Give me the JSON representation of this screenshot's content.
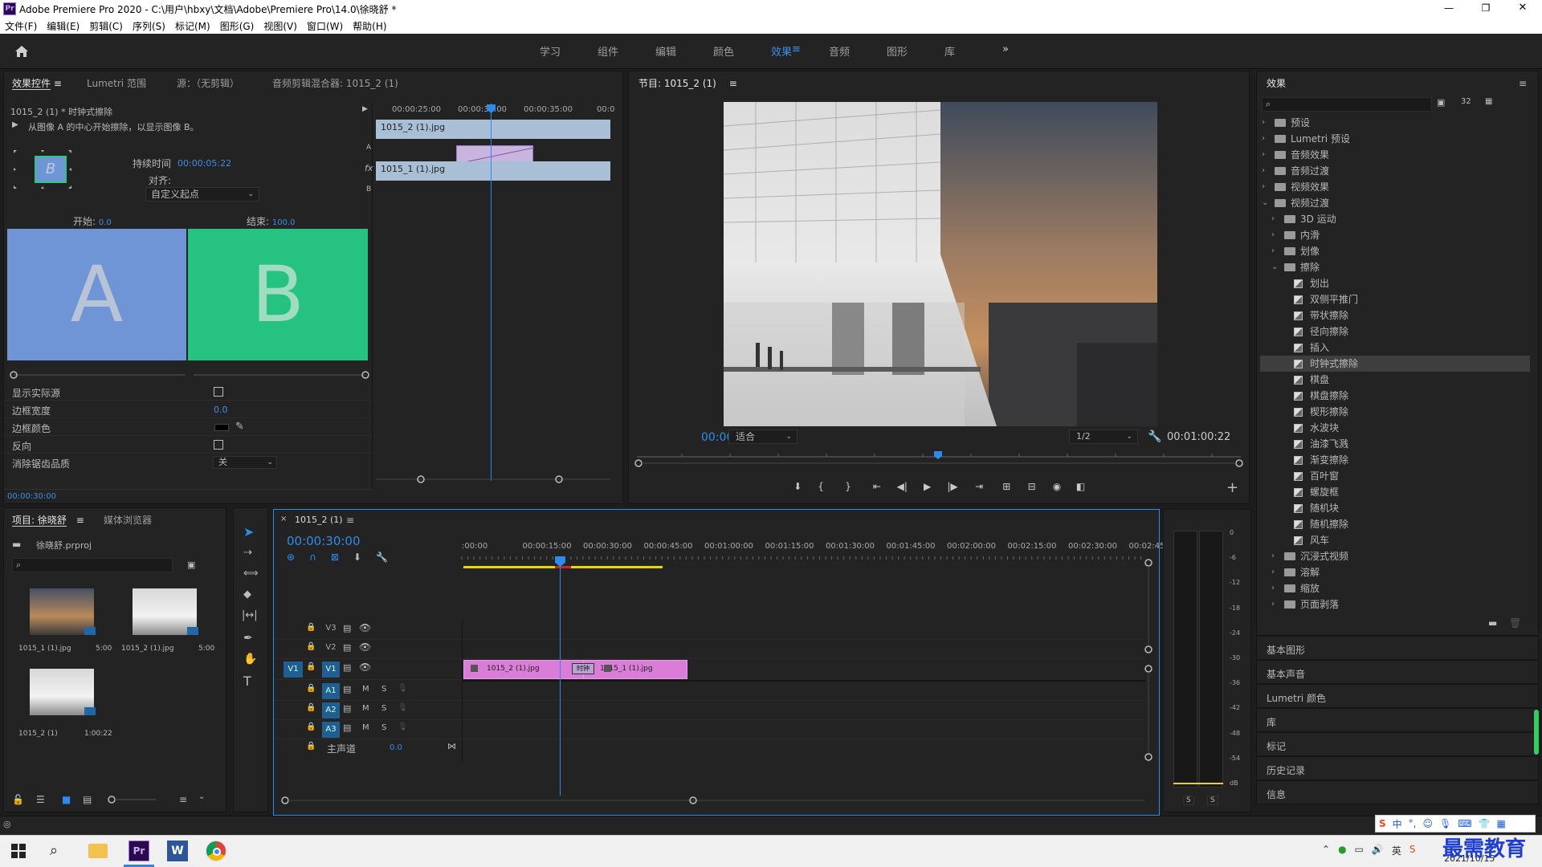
{
  "window": {
    "title": "Adobe Premiere Pro 2020 - C:\\用户\\hbxy\\文档\\Adobe\\Premiere Pro\\14.0\\徐晓舒 *",
    "app_icon": "Pr",
    "controls": [
      "—",
      "❐",
      "✕"
    ]
  },
  "menu": [
    "文件(F)",
    "编辑(E)",
    "剪辑(C)",
    "序列(S)",
    "标记(M)",
    "图形(G)",
    "视图(V)",
    "窗口(W)",
    "帮助(H)"
  ],
  "workspaces": {
    "items": [
      "学习",
      "组件",
      "编辑",
      "颜色",
      "效果",
      "音频",
      "图形",
      "库"
    ],
    "active": "效果",
    "more": "»"
  },
  "effect_controls": {
    "tabs": [
      "效果控件",
      "Lumetri 范围",
      "源：（无剪辑）",
      "音频剪辑混合器: 1015_2 (1)"
    ],
    "clip_title": "1015_2 (1) * 时钟式擦除",
    "description": "从图像 A 的中心开始擦除，以显示图像 B。",
    "thumb_letter": "B",
    "duration_label": "持续时间",
    "duration_value": "00:00:05:22",
    "align_label": "对齐:",
    "align_value": "自定义起点",
    "start_label": "开始:",
    "start_value": "0.0",
    "end_label": "结束:",
    "end_value": "100.0",
    "preview_a": "A",
    "preview_b": "B",
    "props": [
      {
        "label": "显示实际源",
        "type": "checkbox"
      },
      {
        "label": "边框宽度",
        "type": "value",
        "value": "0.0"
      },
      {
        "label": "边框颜色",
        "type": "color"
      },
      {
        "label": "反向",
        "type": "checkbox"
      },
      {
        "label": "消除锯齿品质",
        "type": "select",
        "value": "关"
      }
    ],
    "current_time": "00:00:30:00",
    "mini_timeline": {
      "ticks": [
        "00:00:25:00",
        "00:00:30:00",
        "00:00:35:00",
        "00:0"
      ],
      "clip_a": "1015_2 (1).jpg",
      "clip_b": "1015_1 (1).jpg",
      "track_a": "A",
      "track_b": "B",
      "fx": "fx"
    }
  },
  "program": {
    "title": "节目: 1015_2 (1)",
    "timecode": "00:00:30:00",
    "fit": "适合",
    "resolution": "1/2",
    "duration": "00:01:00:22"
  },
  "project": {
    "tabs": [
      "项目: 徐晓舒",
      "媒体浏览器"
    ],
    "file": "徐晓舒.prproj",
    "items": [
      {
        "name": "1015_1 (1).jpg",
        "duration": "5:00"
      },
      {
        "name": "1015_2 (1).jpg",
        "duration": "5:00"
      },
      {
        "name": "1015_2 (1)",
        "duration": "1:00:22"
      }
    ]
  },
  "timeline": {
    "tab": "1015_2 (1)",
    "timecode": "00:00:30:00",
    "ruler": [
      ":00:00",
      "00:00:15:00",
      "00:00:30:00",
      "00:00:45:00",
      "00:01:00:00",
      "00:01:15:00",
      "00:01:30:00",
      "00:01:45:00",
      "00:02:00:00",
      "00:02:15:00",
      "00:02:30:00",
      "00:02:45:"
    ],
    "video_tracks": [
      "V3",
      "V2",
      "V1"
    ],
    "audio_tracks": [
      "A1",
      "A2",
      "A3"
    ],
    "source_patch": "V1",
    "master_label": "主声道",
    "master_value": "0.0",
    "mute": "M",
    "solo": "S",
    "clip1": "1015_2 (1).jpg",
    "clip2": "1015_1 (1).jpg",
    "transition": "时钟"
  },
  "meter": {
    "scale": [
      "0",
      "-6",
      "-12",
      "-18",
      "-24",
      "-30",
      "-36",
      "-42",
      "-48",
      "-54",
      "dB"
    ],
    "solo": [
      "S",
      "S"
    ]
  },
  "effects": {
    "title": "效果",
    "tree": [
      {
        "label": "预设",
        "level": 0,
        "kind": "folder",
        "expanded": false
      },
      {
        "label": "Lumetri 预设",
        "level": 0,
        "kind": "folder",
        "expanded": false
      },
      {
        "label": "音频效果",
        "level": 0,
        "kind": "folder",
        "expanded": false
      },
      {
        "label": "音频过渡",
        "level": 0,
        "kind": "folder",
        "expanded": false
      },
      {
        "label": "视频效果",
        "level": 0,
        "kind": "folder",
        "expanded": false
      },
      {
        "label": "视频过渡",
        "level": 0,
        "kind": "folder",
        "expanded": true
      },
      {
        "label": "3D 运动",
        "level": 1,
        "kind": "folder",
        "expanded": false
      },
      {
        "label": "内滑",
        "level": 1,
        "kind": "folder",
        "expanded": false
      },
      {
        "label": "划像",
        "level": 1,
        "kind": "folder",
        "expanded": false
      },
      {
        "label": "擦除",
        "level": 1,
        "kind": "folder",
        "expanded": true
      },
      {
        "label": "划出",
        "level": 2,
        "kind": "effect"
      },
      {
        "label": "双侧平推门",
        "level": 2,
        "kind": "effect"
      },
      {
        "label": "带状擦除",
        "level": 2,
        "kind": "effect"
      },
      {
        "label": "径向擦除",
        "level": 2,
        "kind": "effect"
      },
      {
        "label": "插入",
        "level": 2,
        "kind": "effect"
      },
      {
        "label": "时钟式擦除",
        "level": 2,
        "kind": "effect",
        "selected": true
      },
      {
        "label": "棋盘",
        "level": 2,
        "kind": "effect"
      },
      {
        "label": "棋盘擦除",
        "level": 2,
        "kind": "effect"
      },
      {
        "label": "楔形擦除",
        "level": 2,
        "kind": "effect"
      },
      {
        "label": "水波块",
        "level": 2,
        "kind": "effect"
      },
      {
        "label": "油漆飞溅",
        "level": 2,
        "kind": "effect"
      },
      {
        "label": "渐变擦除",
        "level": 2,
        "kind": "effect"
      },
      {
        "label": "百叶窗",
        "level": 2,
        "kind": "effect"
      },
      {
        "label": "螺旋框",
        "level": 2,
        "kind": "effect"
      },
      {
        "label": "随机块",
        "level": 2,
        "kind": "effect"
      },
      {
        "label": "随机擦除",
        "level": 2,
        "kind": "effect"
      },
      {
        "label": "风车",
        "level": 2,
        "kind": "effect"
      },
      {
        "label": "沉浸式视频",
        "level": 1,
        "kind": "folder",
        "expanded": false
      },
      {
        "label": "溶解",
        "level": 1,
        "kind": "folder",
        "expanded": false
      },
      {
        "label": "缩放",
        "level": 1,
        "kind": "folder",
        "expanded": false
      },
      {
        "label": "页面剥落",
        "level": 1,
        "kind": "folder",
        "expanded": false
      }
    ],
    "collapsed_panels": [
      "基本图形",
      "基本声音",
      "Lumetri 颜色",
      "库",
      "标记",
      "历史记录",
      "信息"
    ]
  },
  "taskbar": {
    "date": "2021/10/15",
    "watermark": "最需教育",
    "ime": "中",
    "apps": [
      "Pr",
      "W"
    ]
  },
  "colors": {
    "accent_blue": "#2d8ceb",
    "clip_pink": "#d97dd9",
    "preview_a": "#6f95d6",
    "preview_b": "#25c281"
  }
}
